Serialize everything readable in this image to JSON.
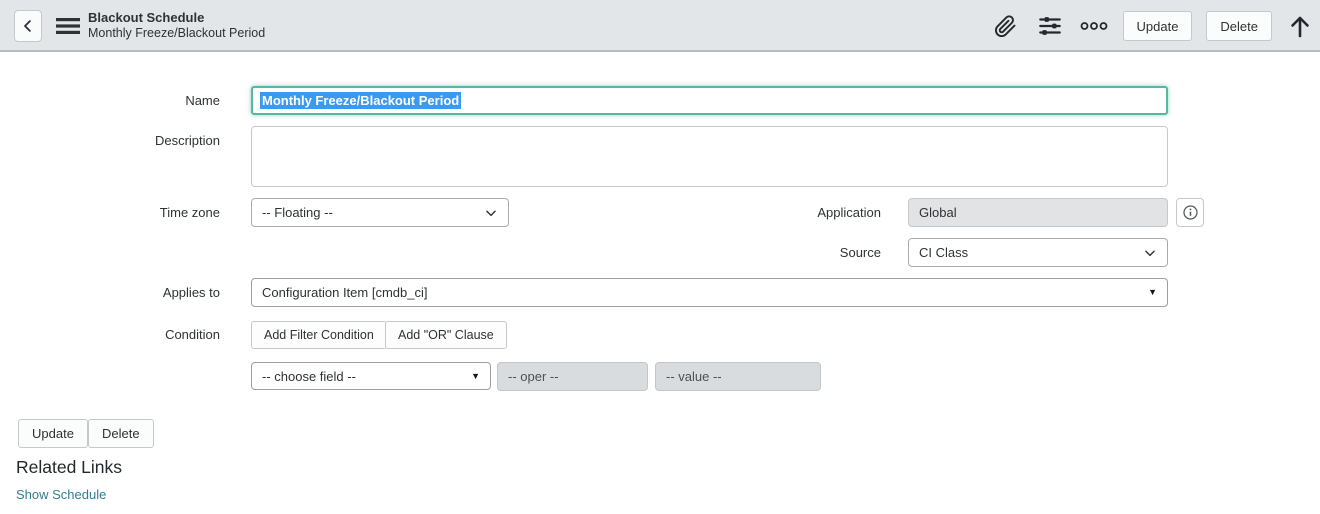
{
  "colors": {
    "header_bg": "#e3e6e8",
    "focus_border": "#57b8a1",
    "selection_bg": "#3b99f0",
    "link": "#327f8d"
  },
  "glyphs": {
    "caret_down": "▼"
  },
  "icons": {
    "back": "chevron-left",
    "menu": "hamburger",
    "attachment": "paperclip",
    "personalize": "sliders",
    "more_options": "ellipsis-circles",
    "scroll_top": "arrow-up",
    "select_chevron": "chevron-down",
    "reference_caret": "filled-triangle-down",
    "application_info": "circle-i"
  },
  "header": {
    "record_type": "Blackout Schedule",
    "record_name": "Monthly Freeze/Blackout Period",
    "update_label": "Update",
    "delete_label": "Delete"
  },
  "form": {
    "name": {
      "label": "Name",
      "value": "Monthly Freeze/Blackout Period"
    },
    "description": {
      "label": "Description",
      "value": ""
    },
    "time_zone": {
      "label": "Time zone",
      "value": "-- Floating --"
    },
    "application": {
      "label": "Application",
      "value": "Global"
    },
    "source": {
      "label": "Source",
      "value": "CI Class"
    },
    "applies_to": {
      "label": "Applies to",
      "value": "Configuration Item [cmdb_ci]"
    },
    "condition": {
      "label": "Condition",
      "add_filter_label": "Add Filter Condition",
      "add_or_label": "Add \"OR\" Clause",
      "field_placeholder": "-- choose field --",
      "oper_placeholder": "-- oper --",
      "value_placeholder": "-- value --"
    }
  },
  "footer": {
    "update_label": "Update",
    "delete_label": "Delete",
    "related_links_title": "Related Links",
    "links": [
      {
        "label": "Show Schedule"
      }
    ]
  }
}
